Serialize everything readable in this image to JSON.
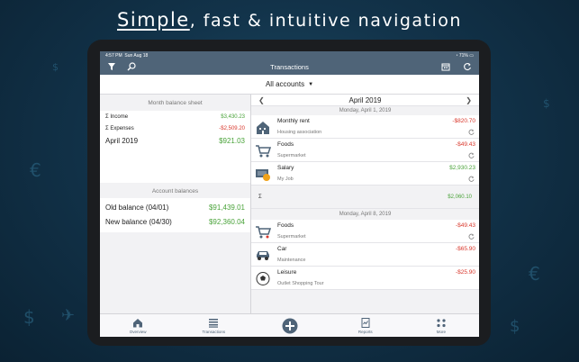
{
  "headline": {
    "emphasis": "Simple",
    "rest": ", fast & intuitive navigation"
  },
  "status_bar": {
    "time": "4:57 PM",
    "date": "Sun Aug 18",
    "battery": "71%"
  },
  "nav": {
    "title": "Transactions",
    "icons": [
      "filter-icon",
      "search-icon",
      "calendar-icon",
      "sync-icon"
    ]
  },
  "accounts": {
    "label": "All accounts"
  },
  "left": {
    "month_title": "Month balance sheet",
    "income_label": "Income",
    "income_value": "$3,430.23",
    "expenses_label": "Expenses",
    "expenses_value": "-$2,509.20",
    "month_label": "April 2019",
    "month_value": "$921.03",
    "balances_title": "Account balances",
    "old_label": "Old balance (04/01)",
    "old_value": "$91,439.01",
    "new_label": "New balance (04/30)",
    "new_value": "$92,360.04"
  },
  "right": {
    "month": "April 2019",
    "days": [
      {
        "header": "Monday, April 1, 2019",
        "transactions": [
          {
            "name": "Monthly rent",
            "sub": "Housing association",
            "amount": "-$820.70",
            "icon": "house-icon",
            "sign": "neg"
          },
          {
            "name": "Foods",
            "sub": "Supermarket",
            "amount": "-$49.43",
            "icon": "cart-icon",
            "sign": "neg"
          },
          {
            "name": "Salary",
            "sub": "My Job",
            "amount": "$2,930.23",
            "icon": "salary-icon",
            "sign": "pos"
          }
        ],
        "sum": "$2,060.10"
      },
      {
        "header": "Monday, April 8, 2019",
        "transactions": [
          {
            "name": "Foods",
            "sub": "Supermarket",
            "amount": "-$49.43",
            "icon": "cart-icon",
            "sign": "neg"
          },
          {
            "name": "Car",
            "sub": "Maintenance",
            "amount": "-$65.90",
            "icon": "car-icon",
            "sign": "neg"
          },
          {
            "name": "Leisure",
            "sub": "Outlet Shopping Tour",
            "amount": "-$25.90",
            "icon": "ball-icon",
            "sign": "neg"
          }
        ]
      }
    ]
  },
  "tabs": [
    {
      "label": "Overview",
      "icon": "home-icon"
    },
    {
      "label": "Transactions",
      "icon": "list-icon"
    },
    {
      "label": "",
      "icon": "add-icon"
    },
    {
      "label": "Reports",
      "icon": "reports-icon"
    },
    {
      "label": "More",
      "icon": "more-icon"
    }
  ],
  "colors": {
    "navbar": "#4f6478",
    "positive": "#4aa33a",
    "negative": "#d9382c",
    "background": "#12334a"
  }
}
